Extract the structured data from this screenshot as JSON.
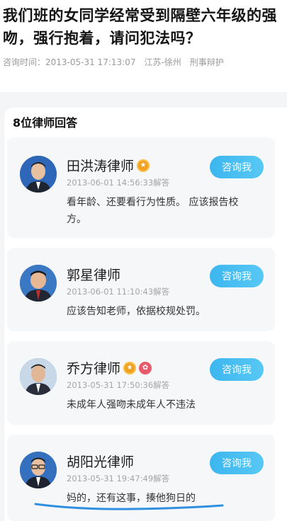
{
  "question": {
    "title": "我们班的女同学经常受到隔壁六年级的强吻，强行抱着，请问犯法吗？",
    "time_label": "咨询时间：2013-05-31 17:13:07",
    "location": "江苏-徐州",
    "category": "刑事辩护"
  },
  "answers_header": "8位律师回答",
  "answers": [
    {
      "name": "田洪涛律师",
      "time": "2013-06-01 14:56:33解答",
      "button": "咨询我",
      "text": "看年龄、还要看行为性质。 应该报告校方。"
    },
    {
      "name": "郭星律师",
      "time": "2013-06-01 11:10:43解答",
      "button": "咨询我",
      "text": "应该告知老师，依据校规处罚。"
    },
    {
      "name": "乔方律师",
      "time": "2013-05-31 17:50:36解答",
      "button": "咨询我",
      "text": "未成年人强吻未成年人不违法"
    },
    {
      "name": "胡阳光律师",
      "time": "2013-05-31 19:47:49解答",
      "button": "咨询我",
      "text": "妈的，还有这事，揍他狗日的"
    }
  ],
  "colors": {
    "accent": "#3cb6f0",
    "underline": "#2f8fe0"
  }
}
